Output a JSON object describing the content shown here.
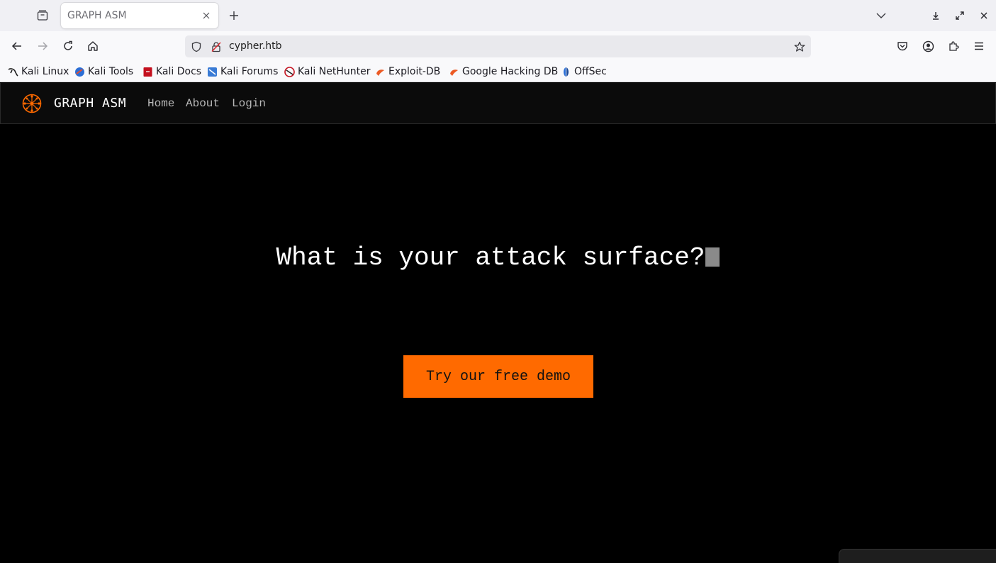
{
  "browser": {
    "tab_title": "GRAPH ASM",
    "url": "cypher.htb",
    "bookmarks": [
      {
        "label": "Kali Linux",
        "icon": "kali-dragon-icon"
      },
      {
        "label": "Kali Tools",
        "icon": "kali-tools-icon"
      },
      {
        "label": "Kali Docs",
        "icon": "kali-docs-icon"
      },
      {
        "label": "Kali Forums",
        "icon": "kali-forums-icon"
      },
      {
        "label": "Kali NetHunter",
        "icon": "kali-nethunter-icon"
      },
      {
        "label": "Exploit-DB",
        "icon": "exploit-db-icon"
      },
      {
        "label": "Google Hacking DB",
        "icon": "ghdb-icon"
      },
      {
        "label": "OffSec",
        "icon": "offsec-icon"
      }
    ]
  },
  "site": {
    "brand": "GRAPH ASM",
    "nav": [
      "Home",
      "About",
      "Login"
    ],
    "hero_text": "What is your attack surface?",
    "cta_label": "Try our free demo",
    "accent_color": "#ff6a00"
  }
}
